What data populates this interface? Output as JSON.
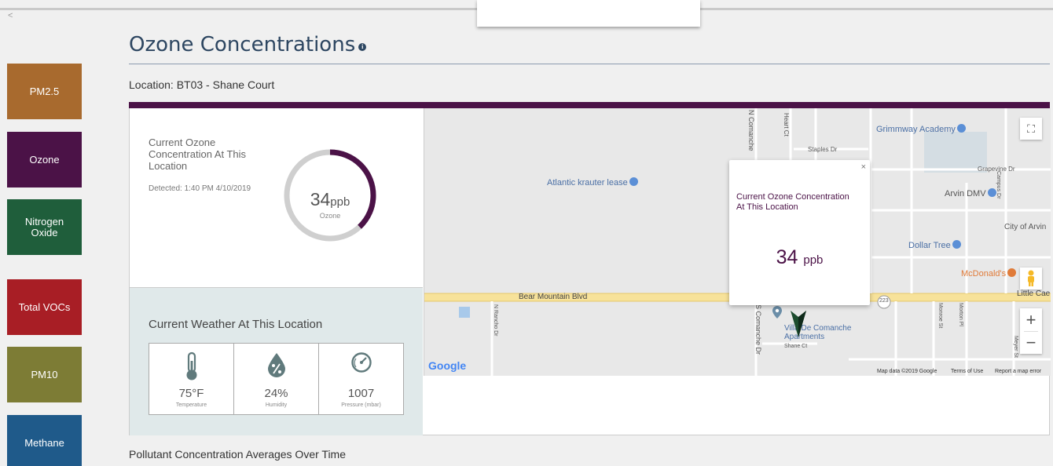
{
  "collapse_label": "<",
  "sidebar": {
    "items": [
      {
        "label": "PM2.5",
        "color": "#a86a2e"
      },
      {
        "label": "Ozone",
        "color": "#4b1247"
      },
      {
        "label": "Nitrogen Oxide",
        "color": "#1f5e3b"
      },
      {
        "label": "Total VOCs",
        "color": "#a81e25"
      },
      {
        "label": "PM10",
        "color": "#7d7c35"
      },
      {
        "label": "Methane",
        "color": "#1f5a8a"
      }
    ]
  },
  "header": {
    "title": "Ozone Concentrations",
    "info_glyph": "i",
    "location": "Location: BT03 - Shane Court"
  },
  "concentration": {
    "title": "Current Ozone Concentration At This Location",
    "detected": "Detected: 1:40 PM 4/10/2019",
    "value": "34",
    "unit": "ppb",
    "pollutant": "Ozone",
    "gauge_fraction": 0.38,
    "accent": "#4b1247"
  },
  "weather": {
    "title": "Current Weather At This Location",
    "cells": [
      {
        "icon": "thermometer-icon",
        "value": "75°F",
        "label": "Temperature"
      },
      {
        "icon": "humidity-drop-icon",
        "value": "24%",
        "label": "Humidity"
      },
      {
        "icon": "pressure-gauge-icon",
        "value": "1007",
        "label": "Pressure (mbar)"
      }
    ]
  },
  "map": {
    "labels": {
      "grimmway": "Grimmway Academy",
      "staples": "Staples Dr",
      "grapevine": "Grapevine Dr",
      "atlantic": "Atlantic krauter lease",
      "arvin_dmv": "Arvin DMV",
      "city_of_arvin": "City of Arvin",
      "dollar_tree": "Dollar Tree",
      "mcdonalds": "McDonald's",
      "bear_mountain": "Bear Mountain Blvd",
      "little_cae": "Little Cae",
      "villa": "Villa De Comanche Apartments",
      "shane_ct": "Shane Ct",
      "n_comanche": "N Comanche",
      "s_comanche": "S Comanche Dr",
      "n_rancho": "N Rancho Dr",
      "monroe": "Monroe St",
      "morton": "Morton Pl",
      "hwy": "223",
      "heart": "Heart Ct",
      "campus": "Campus Dr",
      "meyer": "Meyer St",
      "google": "Google",
      "map_data": "Map data ©2019 Google",
      "terms": "Terms of Use",
      "report": "Report a map error"
    },
    "zoom_in": "+",
    "zoom_out": "−",
    "fullscreen": "⛶",
    "popup": {
      "close": "×",
      "title": "Current Ozone Concentration At This Location",
      "value": "34",
      "unit": "ppb"
    }
  },
  "section2": {
    "title": "Pollutant Concentration Averages Over Time"
  }
}
